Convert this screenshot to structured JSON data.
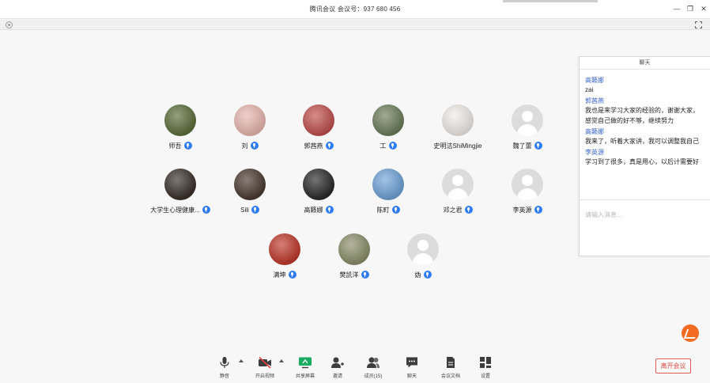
{
  "window": {
    "title": "腾讯会议  会议号：937 680 456",
    "min_label": "—",
    "max_label": "❐",
    "close_label": "✕"
  },
  "participants": [
    {
      "name": "师吾",
      "mic": true,
      "avatar": "photo",
      "color": "#5b6e3a"
    },
    {
      "name": "刘",
      "mic": true,
      "avatar": "photo",
      "color": "#e8b7b0"
    },
    {
      "name": "郭茜燕",
      "mic": true,
      "avatar": "photo",
      "color": "#c0504d"
    },
    {
      "name": "工",
      "mic": true,
      "avatar": "photo",
      "color": "#6b7d5a"
    },
    {
      "name": "史明洁ShiMingjie",
      "mic": false,
      "avatar": "photo",
      "color": "#f1ece8"
    },
    {
      "name": "魏了蕾",
      "mic": true,
      "avatar": "default",
      "color": "#dcdcdc"
    },
    {
      "name": "大学生心理健康...",
      "mic": true,
      "avatar": "photo",
      "color": "#3a2f2a"
    },
    {
      "name": "Sili",
      "mic": true,
      "avatar": "photo",
      "color": "#4a3a30"
    },
    {
      "name": "高籁娜",
      "mic": true,
      "avatar": "photo",
      "color": "#2a2a2a"
    },
    {
      "name": "陈町",
      "mic": true,
      "avatar": "photo",
      "color": "#6fa3d8"
    },
    {
      "name": "邓之君",
      "mic": true,
      "avatar": "default",
      "color": "#dcdcdc"
    },
    {
      "name": "李英源",
      "mic": true,
      "avatar": "default",
      "color": "#dcdcdc"
    },
    {
      "name": "满坤",
      "mic": true,
      "avatar": "photo",
      "color": "#c0392b"
    },
    {
      "name": "樊凯洋",
      "mic": true,
      "avatar": "photo",
      "color": "#8a8f6a"
    },
    {
      "name": "妫",
      "mic": true,
      "avatar": "default",
      "color": "#dcdcdc"
    }
  ],
  "chat": {
    "title": "聊天",
    "messages": [
      {
        "sender": "高籁娜",
        "lines": [
          "zai"
        ]
      },
      {
        "sender": "郭茜燕",
        "lines": [
          "我也是来学习大家的经验的，谢谢大家，",
          "感觉自己做的好不够，继续努力"
        ]
      },
      {
        "sender": "高籁娜",
        "lines": [
          "我来了，听着大家讲，我可以调整我自己"
        ]
      },
      {
        "sender": "李英源",
        "lines": [
          "学习到了很多，真是用心，以后计需要好"
        ]
      }
    ],
    "input_placeholder": "请输入消息..."
  },
  "toolbar": {
    "items": [
      {
        "label": "静音",
        "icon": "mic-icon"
      },
      {
        "label": "开启视频",
        "icon": "video-off-icon"
      },
      {
        "label": "共享屏幕",
        "icon": "share-screen-icon"
      },
      {
        "label": "邀请",
        "icon": "invite-icon"
      },
      {
        "label": "成员(15)",
        "icon": "members-icon"
      },
      {
        "label": "聊天",
        "icon": "chat-icon"
      },
      {
        "label": "会议文档",
        "icon": "document-icon"
      },
      {
        "label": "设置",
        "icon": "settings-icon"
      }
    ],
    "leave_label": "离开会议"
  },
  "colors": {
    "accent": "#2f7cf6",
    "leave": "#e0433a",
    "share_green": "#1aad5f",
    "logo": "#f26b21"
  }
}
